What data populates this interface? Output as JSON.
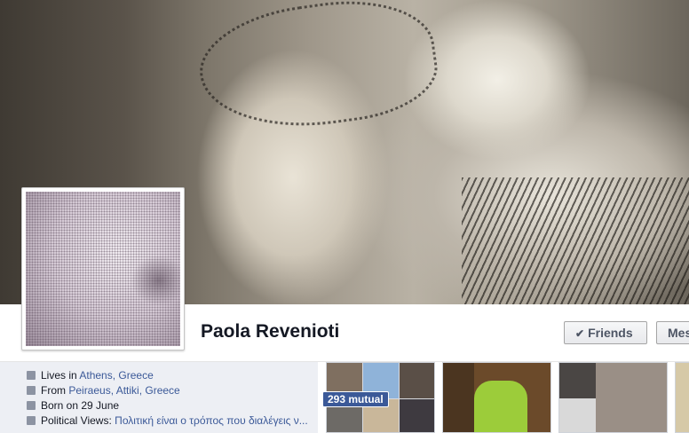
{
  "profile": {
    "name": "Paola Revenioti",
    "friends_label": "Friends",
    "message_label": "Message"
  },
  "about": {
    "lives_prefix": "Lives in",
    "lives_city": "Athens, Greece",
    "from_prefix": "From",
    "from_place": "Peiraeus, Attiki, Greece",
    "born": "Born on 29 June",
    "political_prefix": "Political Views:",
    "political_text": "Πολιτική είναι ο τρόπος που διαλέγεις ν..."
  },
  "photos": {
    "mutual_badge": "293 mutual"
  },
  "icons": [
    "home-icon",
    "house-icon",
    "calendar-icon",
    "speech-bubble-icon",
    "checkmark-icon"
  ],
  "colors": {
    "link": "#3b5998",
    "badge": "#3b5998",
    "about_bg": "#edeff4"
  }
}
